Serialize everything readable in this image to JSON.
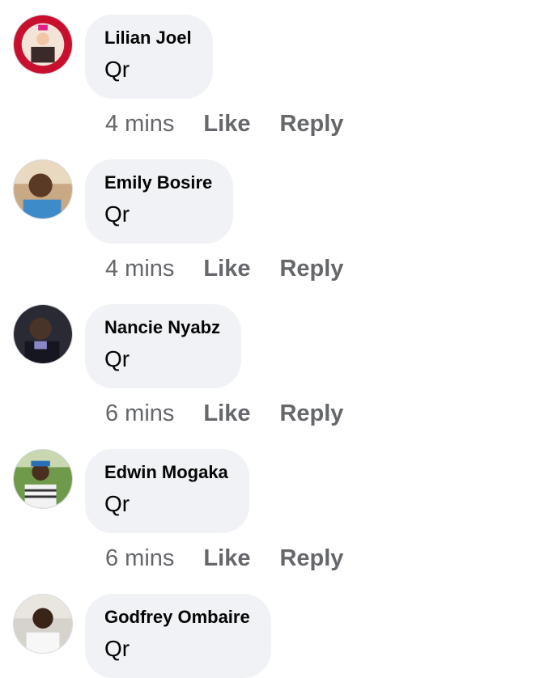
{
  "comments": [
    {
      "author": "Lilian Joel",
      "text": "Qr",
      "time": "4 mins",
      "like_label": "Like",
      "reply_label": "Reply",
      "avatar_icon": "profile-photo"
    },
    {
      "author": "Emily Bosire",
      "text": "Qr",
      "time": "4 mins",
      "like_label": "Like",
      "reply_label": "Reply",
      "avatar_icon": "profile-photo"
    },
    {
      "author": "Nancie Nyabz",
      "text": "Qr",
      "time": "6 mins",
      "like_label": "Like",
      "reply_label": "Reply",
      "avatar_icon": "profile-photo"
    },
    {
      "author": "Edwin Mogaka",
      "text": "Qr",
      "time": "6 mins",
      "like_label": "Like",
      "reply_label": "Reply",
      "avatar_icon": "profile-photo"
    },
    {
      "author": "Godfrey Ombaire",
      "text": "Qr"
    }
  ],
  "colors": {
    "bubble_bg": "#f0f2f5",
    "meta_text": "#65676b",
    "author_text": "#050505"
  }
}
